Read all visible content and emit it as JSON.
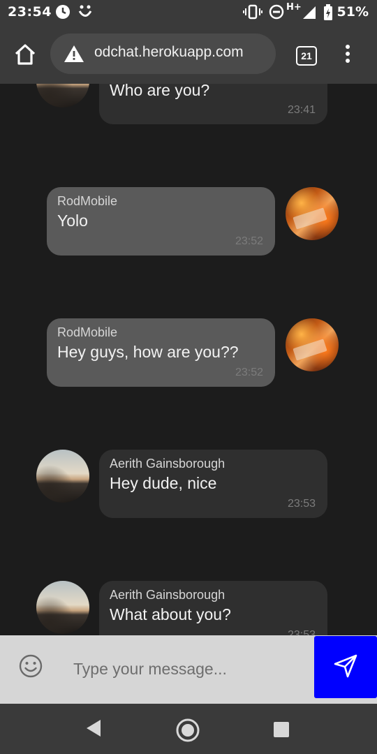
{
  "status_bar": {
    "time": "23:54",
    "network": "H+",
    "battery": "51%"
  },
  "browser": {
    "url": "odchat.herokuapp.com",
    "tab_count": "21"
  },
  "messages": [
    {
      "sender": "",
      "text": "Who are you?",
      "time": "23:41",
      "direction": "in"
    },
    {
      "sender": "RodMobile",
      "text": "Yolo",
      "time": "23:52",
      "direction": "out"
    },
    {
      "sender": "RodMobile",
      "text": "Hey guys, how are you??",
      "time": "23:52",
      "direction": "out"
    },
    {
      "sender": "Aerith Gainsborough",
      "text": "Hey dude, nice",
      "time": "23:53",
      "direction": "in"
    },
    {
      "sender": "Aerith Gainsborough",
      "text": "What about you?",
      "time": "23:53",
      "direction": "in"
    }
  ],
  "composer": {
    "placeholder": "Type your message...",
    "value": ""
  },
  "colors": {
    "send_button": "#0000ff",
    "background": "#1c1c1c",
    "incoming_bubble": "#2f2f2f",
    "outgoing_bubble": "#5a5a5a"
  }
}
